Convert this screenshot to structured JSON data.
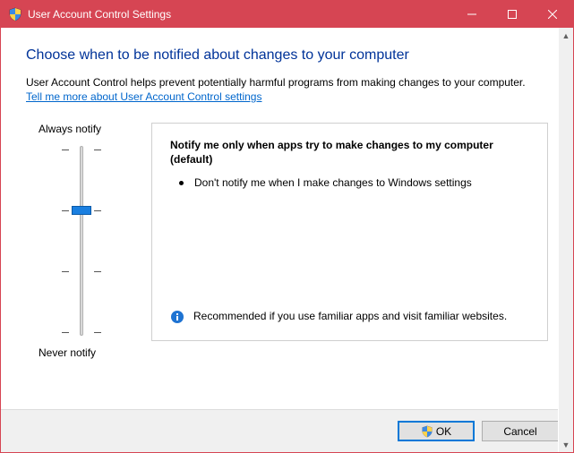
{
  "titlebar": {
    "title": "User Account Control Settings"
  },
  "heading": "Choose when to be notified about changes to your computer",
  "intro": "User Account Control helps prevent potentially harmful programs from making changes to your computer.",
  "help_link": "Tell me more about User Account Control settings",
  "slider": {
    "top_label": "Always notify",
    "bottom_label": "Never notify",
    "levels": 4,
    "current_level": 2
  },
  "detail": {
    "title": "Notify me only when apps try to make changes to my computer (default)",
    "bullet": "Don't notify me when I make changes to Windows settings",
    "recommendation": "Recommended if you use familiar apps and visit familiar websites."
  },
  "buttons": {
    "ok": "OK",
    "cancel": "Cancel"
  }
}
